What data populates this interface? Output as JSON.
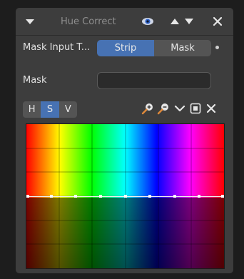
{
  "panel": {
    "title": "Hue Correct"
  },
  "mask_input": {
    "label": "Mask Input T...",
    "options": [
      "Strip",
      "Mask"
    ],
    "selected": "Strip"
  },
  "mask": {
    "label": "Mask",
    "value": ""
  },
  "channels": {
    "items": [
      "H",
      "S",
      "V"
    ],
    "selected": "S"
  },
  "toolbar": {
    "icons": [
      "zoom-in-icon",
      "zoom-out-icon",
      "chevron-down-icon",
      "clip-icon",
      "reset-x-icon"
    ]
  },
  "curve": {
    "point_count": 9,
    "level": 0.5
  },
  "colors": {
    "accent": "#4772b3",
    "panel_bg": "#3d3d3d",
    "button_bg": "#545454",
    "title_text": "#8f8f8f"
  }
}
